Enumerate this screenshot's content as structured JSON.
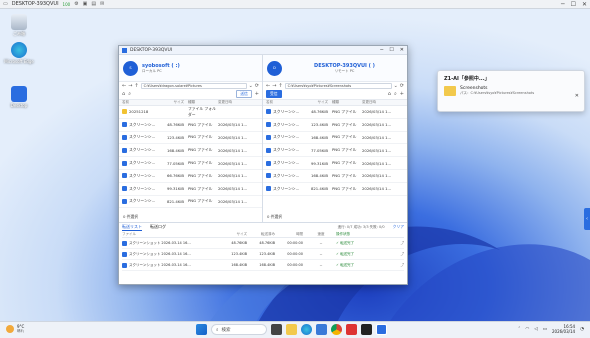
{
  "rdbar": {
    "title": "DESKTOP-393QVUI",
    "signal": "100"
  },
  "desktop_icons": [
    {
      "label": "ごみ箱"
    },
    {
      "label": "Microsoft Edge"
    },
    {
      "label": "Desktop"
    }
  ],
  "window": {
    "title": "DESKTOP-393QVUI",
    "left": {
      "name": "syobosoft",
      "id_masked": "( :)",
      "sub": "ローカル PC",
      "path": "C:¥Users¥dragon-solare¥Pictures",
      "btn_label": "送信",
      "columns": [
        "名前",
        "サイズ",
        "種類",
        "変更日時"
      ],
      "rows": [
        {
          "name": "20251218",
          "size": "",
          "type": "ファイル フォルダー",
          "date": "",
          "folder": true
        },
        {
          "name": "スクリーンシ...",
          "size": "48.76KiB",
          "type": "PNG ファイル",
          "date": "2026/03/14 1..."
        },
        {
          "name": "スクリーンシ...",
          "size": "123.4KiB",
          "type": "PNG ファイル",
          "date": "2026/03/14 1..."
        },
        {
          "name": "スクリーンシ...",
          "size": "168.4KiB",
          "type": "PNG ファイル",
          "date": "2026/03/14 1..."
        },
        {
          "name": "スクリーンシ...",
          "size": "77.05KiB",
          "type": "PNG ファイル",
          "date": "2026/03/14 1..."
        },
        {
          "name": "スクリーンシ...",
          "size": "66.76KiB",
          "type": "PNG ファイル",
          "date": "2026/03/14 1..."
        },
        {
          "name": "スクリーンシ...",
          "size": "99.31KiB",
          "type": "PNG ファイル",
          "date": "2026/03/14 1..."
        },
        {
          "name": "スクリーンシ...",
          "size": "821.4KiB",
          "type": "PNG ファイル",
          "date": "2026/03/14 1..."
        }
      ],
      "selection": "0 件選択"
    },
    "right": {
      "name": "DESKTOP-393QVUI",
      "id_masked": "( )",
      "sub": "リモート PC",
      "path": "C:¥Users¥syo¥Pictures¥Screenshots",
      "btn_label": "受信",
      "columns": [
        "名前",
        "サイズ",
        "種類",
        "変更日時"
      ],
      "rows": [
        {
          "name": "スクリーンシ...",
          "size": "48.76KiB",
          "type": "PNG ファイル",
          "date": "2026/03/14 1..."
        },
        {
          "name": "スクリーンシ...",
          "size": "123.4KiB",
          "type": "PNG ファイル",
          "date": "2026/03/14 1..."
        },
        {
          "name": "スクリーンシ...",
          "size": "168.4KiB",
          "type": "PNG ファイル",
          "date": "2026/03/14 1..."
        },
        {
          "name": "スクリーンシ...",
          "size": "77.05KiB",
          "type": "PNG ファイル",
          "date": "2026/03/14 1..."
        },
        {
          "name": "スクリーンシ...",
          "size": "99.31KiB",
          "type": "PNG ファイル",
          "date": "2026/03/14 1..."
        },
        {
          "name": "スクリーンシ...",
          "size": "168.4KiB",
          "type": "PNG ファイル",
          "date": "2026/03/14 1..."
        },
        {
          "name": "スクリーンシ...",
          "size": "821.4KiB",
          "type": "PNG ファイル",
          "date": "2026/03/14 1..."
        }
      ],
      "selection": "0 件選択"
    },
    "transfer": {
      "tab_active": "転送リスト",
      "tab_other": "転送ログ",
      "status": "進行: 0/7  成功: 3/3  失敗: 0/0",
      "clear_label": "クリア",
      "columns": [
        "ファイル",
        "サイズ",
        "転送済み",
        "時間",
        "速度",
        "操作状態",
        ""
      ],
      "rows": [
        {
          "file": "スクリーンショット 2026-03-14 16...",
          "size": "48.76KiB",
          "done": "48.76KiB",
          "time": "00:00:00",
          "speed": "--",
          "status": "転送完了"
        },
        {
          "file": "スクリーンショット 2026-03-14 16...",
          "size": "123.4KiB",
          "done": "123.4KiB",
          "time": "00:00:00",
          "speed": "--",
          "status": "転送完了"
        },
        {
          "file": "スクリーンショット 2026-03-14 16...",
          "size": "168.4KiB",
          "done": "168.4KiB",
          "time": "00:00:00",
          "speed": "--",
          "status": "転送完了"
        }
      ]
    }
  },
  "notification": {
    "title": "Z1-AI「参照中...」",
    "item": "Screenshots",
    "path": "パス：C:¥Users¥syo¥Pictures¥Screenshots"
  },
  "taskbar": {
    "temp": "9°C",
    "weather": "晴れ",
    "search_placeholder": "検索",
    "time": "16:54",
    "date": "2026/03/14"
  }
}
